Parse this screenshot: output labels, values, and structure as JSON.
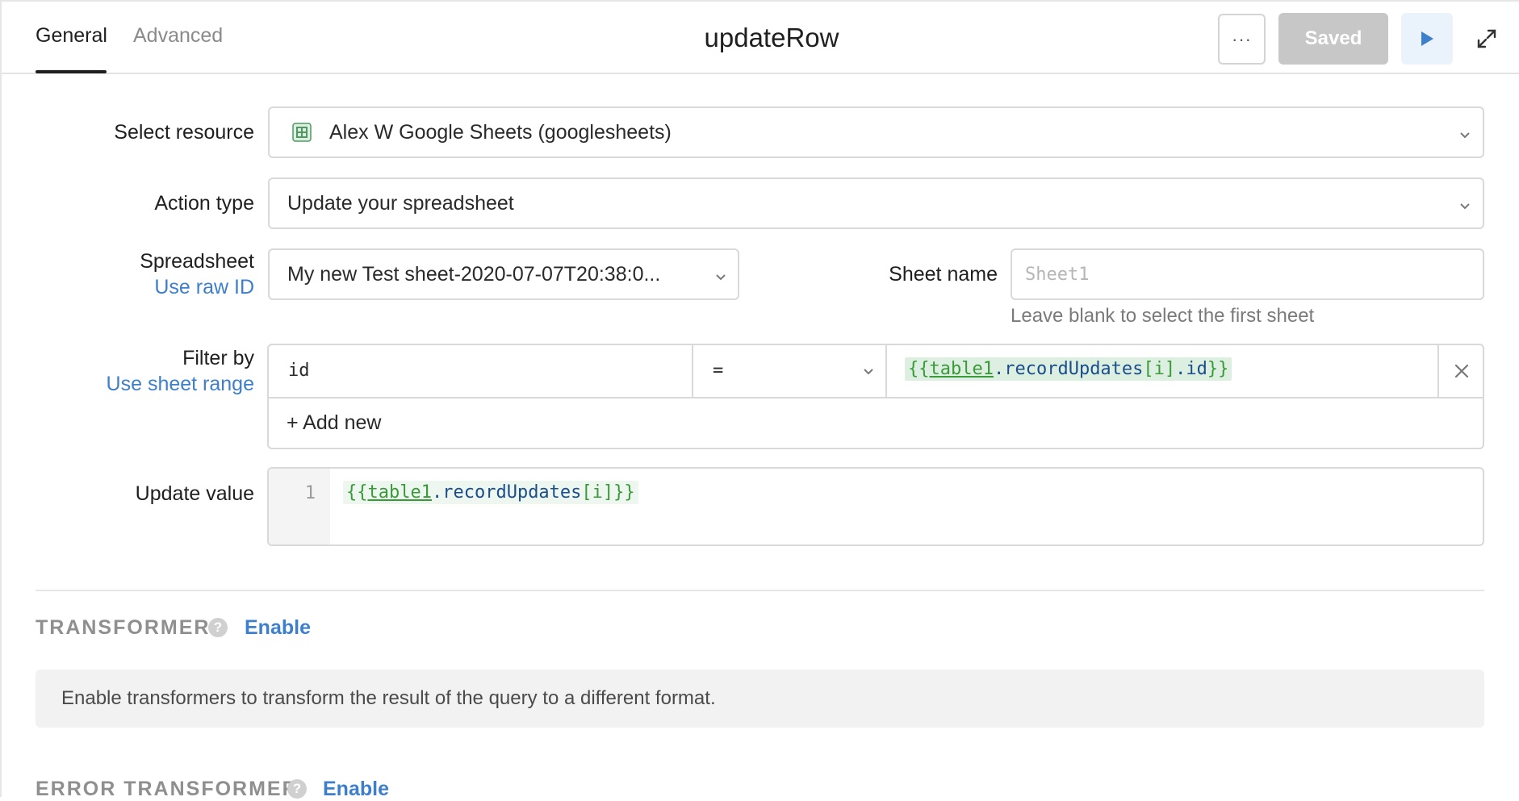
{
  "header": {
    "tabs": [
      {
        "label": "General",
        "active": true
      },
      {
        "label": "Advanced",
        "active": false
      }
    ],
    "title": "updateRow",
    "more_label": "···",
    "saved_label": "Saved"
  },
  "form": {
    "resource": {
      "label": "Select resource",
      "value": "Alex W Google Sheets (googlesheets)",
      "icon": "google-sheets-icon"
    },
    "action_type": {
      "label": "Action type",
      "value": "Update your spreadsheet"
    },
    "spreadsheet": {
      "label": "Spreadsheet",
      "link": "Use raw ID",
      "value": "My new Test sheet-2020-07-07T20:38:0..."
    },
    "sheet_name": {
      "label": "Sheet name",
      "placeholder": "Sheet1",
      "hint": "Leave blank to select the first sheet"
    },
    "filter": {
      "label": "Filter by",
      "link": "Use sheet range",
      "key": "id",
      "operator": "=",
      "value_open": "{{",
      "value_var": "table1",
      "value_prop": ".recordUpdates",
      "value_index": "[i]",
      "value_field": ".id",
      "value_close": "}}",
      "add_new": "+ Add new"
    },
    "update_value": {
      "label": "Update value",
      "line_number": "1",
      "code_open": "{{",
      "code_var": "table1",
      "code_prop": ".recordUpdates",
      "code_index": "[i]",
      "code_close": "}}"
    }
  },
  "transformer": {
    "title": "TRANSFORMER",
    "help": "?",
    "enable": "Enable",
    "info": "Enable transformers to transform the result of the query to a different format."
  },
  "error_transformer": {
    "title": "ERROR TRANSFORMER",
    "help": "?",
    "enable": "Enable"
  },
  "colors": {
    "accent": "#3d7fcc",
    "saved_bg": "#c7c7c7",
    "template_green": "#3a9a3a",
    "template_blue": "#1a4d8c"
  }
}
